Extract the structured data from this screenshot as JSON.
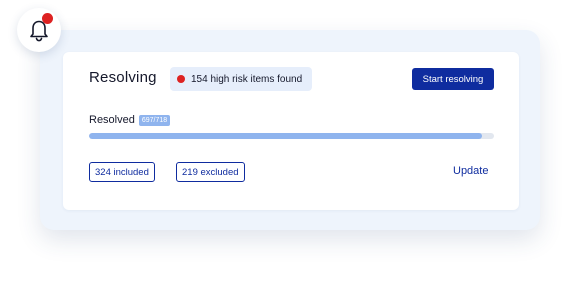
{
  "colors": {
    "accent": "#0f2c9f",
    "alert": "#dd2222",
    "progress": "#8fb4ee",
    "card_background": "#eef4fc"
  },
  "notification": {
    "icon": "bell-icon",
    "has_unread": true
  },
  "card": {
    "title": "Resolving",
    "alert_text": "154 high risk items found",
    "start_button_label": "Start resolving"
  },
  "progress": {
    "label": "Resolved",
    "count_text": "697/718",
    "resolved": 697,
    "total": 718
  },
  "filters": {
    "included_label": "324 included",
    "excluded_label": "219 excluded"
  },
  "actions": {
    "update_label": "Update"
  }
}
